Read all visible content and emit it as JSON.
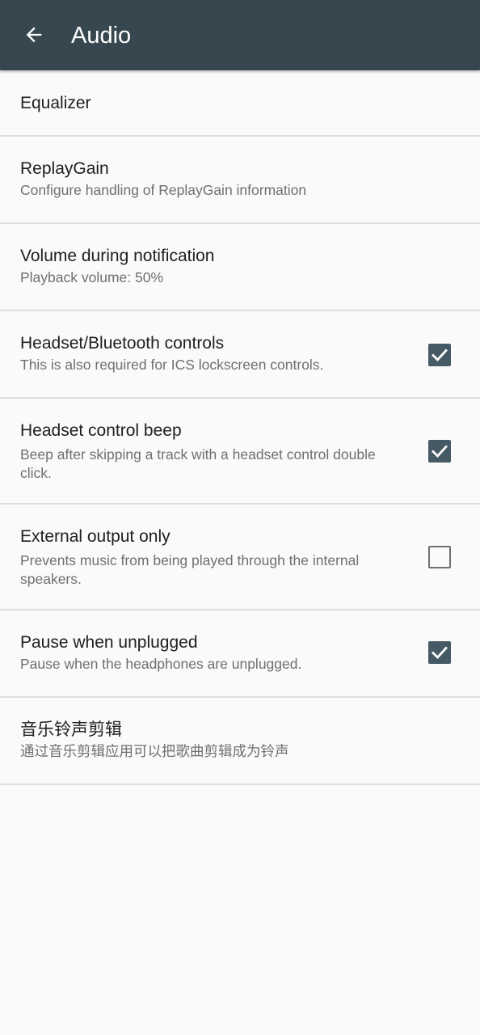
{
  "appbar": {
    "title": "Audio",
    "background": "#37474f",
    "back_icon": "arrow-left-icon"
  },
  "items": [
    {
      "title": "Equalizer"
    },
    {
      "title": "ReplayGain",
      "summary": "Configure handling of ReplayGain information"
    },
    {
      "title": "Volume during notification",
      "summary": "Playback volume: 50%"
    },
    {
      "title": "Headset/Bluetooth controls",
      "summary": "This is also required for ICS lockscreen controls.",
      "checked": true
    },
    {
      "title": "Headset control beep",
      "summary": "Beep after skipping a track with a headset control double click.",
      "checked": true
    },
    {
      "title": "External output only",
      "summary": "Prevents music from being played through the internal speakers.",
      "checked": false
    },
    {
      "title": "Pause when unplugged",
      "summary": "Pause when the headphones are unplugged.",
      "checked": true
    },
    {
      "title": "音乐铃声剪辑",
      "summary": "通过音乐剪辑应用可以把歌曲剪辑成为铃声"
    }
  ],
  "colors": {
    "checkbox_checked": "#455a64",
    "checkbox_unchecked_border": "#707070",
    "divider": "#dedede"
  }
}
